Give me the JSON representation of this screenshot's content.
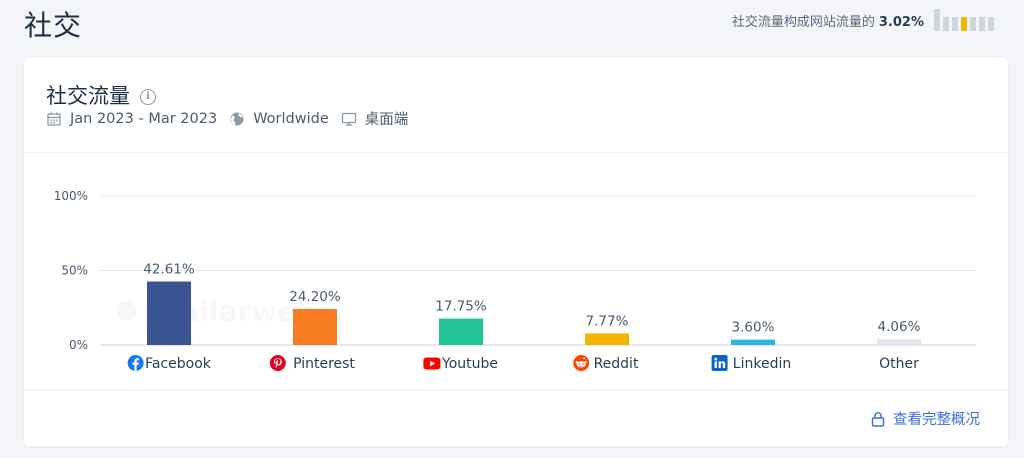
{
  "page": {
    "title": "社交",
    "share_text": "社交流量构成网站流量的",
    "share_value": "3.02%",
    "mini_bars": {
      "count": 7,
      "highlight_index": 3,
      "highlight_color": "#f5b400",
      "base_color": "#cfd6df"
    }
  },
  "card": {
    "title": "社交流量",
    "date_range": "Jan 2023 - Mar 2023",
    "region": "Worldwide",
    "device": "桌面端",
    "footer_link": "查看完整概况"
  },
  "chart_data": {
    "type": "bar",
    "categories": [
      "Facebook",
      "Pinterest",
      "Youtube",
      "Reddit",
      "Linkedin",
      "Other"
    ],
    "values": [
      42.61,
      24.2,
      17.75,
      7.77,
      3.6,
      4.06
    ],
    "value_labels": [
      "42.61%",
      "24.20%",
      "17.75%",
      "7.77%",
      "3.60%",
      "4.06%"
    ],
    "colors": [
      "#3b5593",
      "#f57c22",
      "#22c496",
      "#f5b400",
      "#2bb6e1",
      "#e3e7ec"
    ],
    "icons": [
      "facebook-icon",
      "pinterest-icon",
      "youtube-icon",
      "reddit-icon",
      "linkedin-icon",
      ""
    ],
    "y_ticks": [
      0,
      50,
      100
    ],
    "y_tick_labels": [
      "0%",
      "50%",
      "100%"
    ],
    "ylim": [
      0,
      100
    ],
    "grid": true,
    "watermark": "similarweb",
    "title": "",
    "xlabel": "",
    "ylabel": ""
  }
}
